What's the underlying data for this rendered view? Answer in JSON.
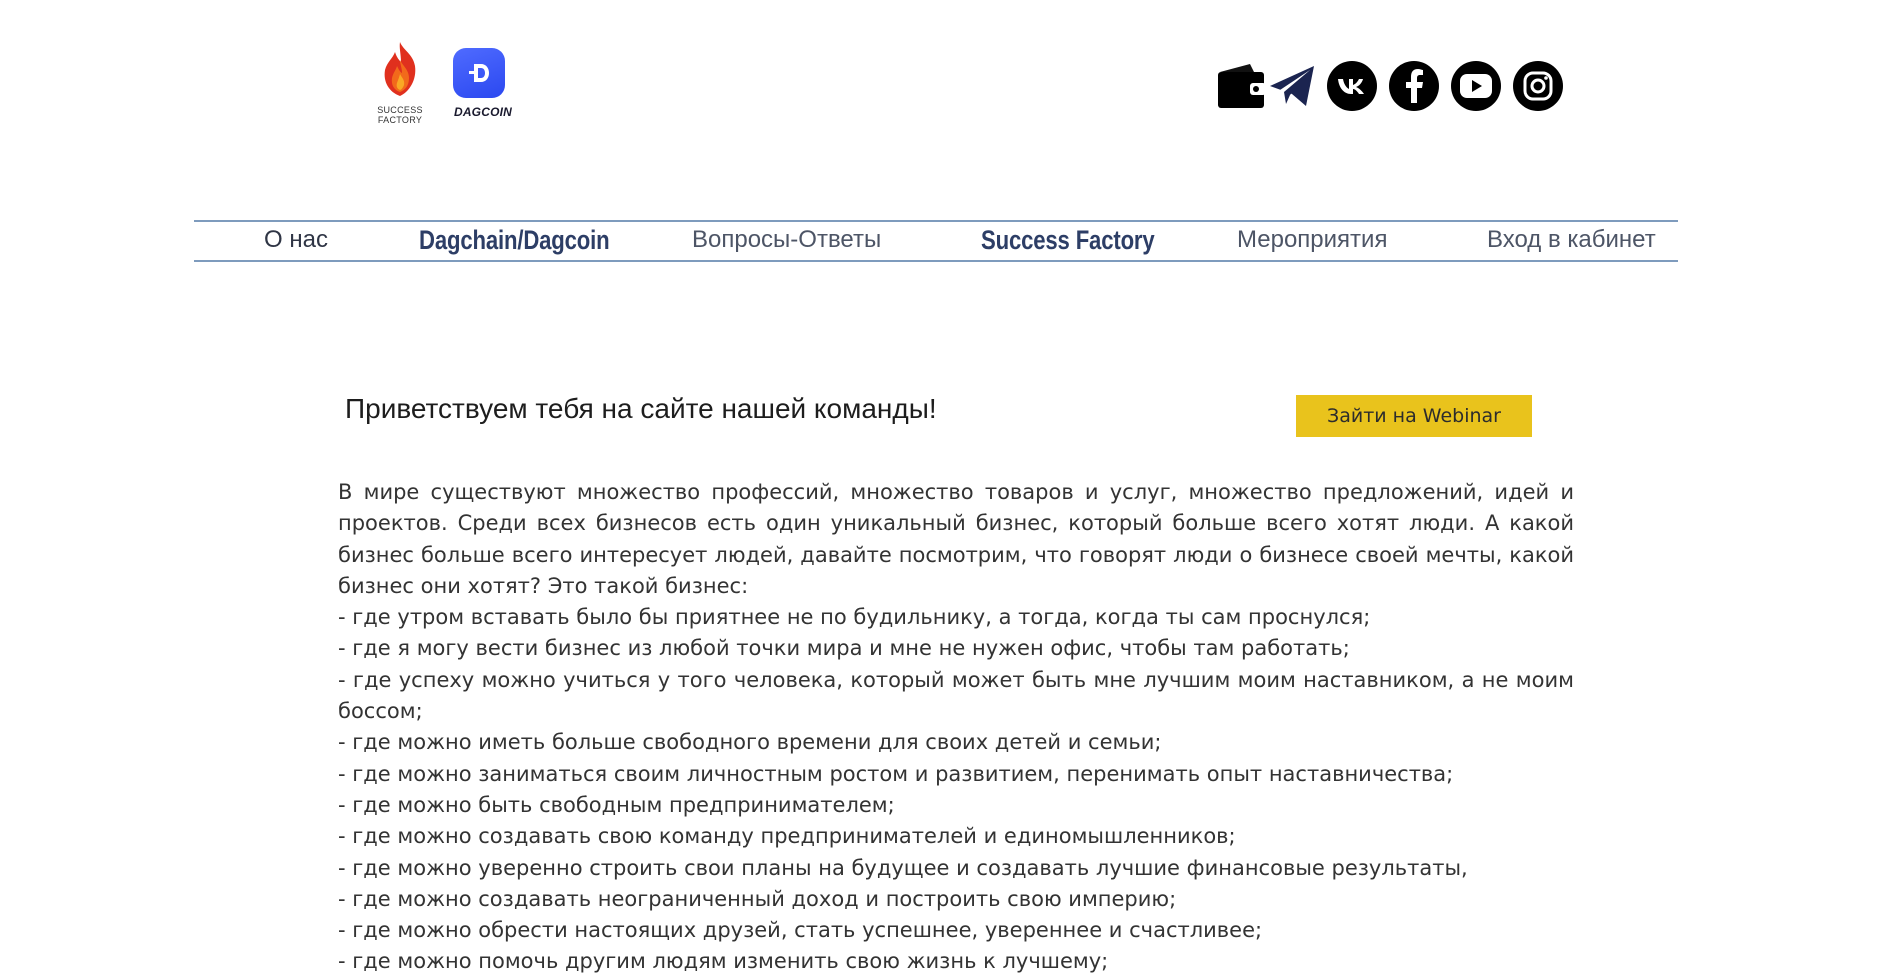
{
  "header": {
    "logo_success_factory": {
      "line1": "SUCCESS",
      "line2": "FACTORY"
    },
    "logo_dagcoin": {
      "word": "DAGCOIN"
    },
    "social_icons": [
      "wallet-icon",
      "telegram-icon",
      "vk-icon",
      "facebook-icon",
      "youtube-icon",
      "instagram-icon"
    ]
  },
  "nav": {
    "items": [
      {
        "label": "О нас"
      },
      {
        "label": "Dagchain/Dagcoin"
      },
      {
        "label": "Вопросы-Ответы"
      },
      {
        "label": "Success Factory"
      },
      {
        "label": "Мероприятия"
      },
      {
        "label": "Вход в кабинет"
      }
    ]
  },
  "main": {
    "greeting": "Приветствуем тебя на сайте нашей команды!",
    "webinar_button": "Зайти на Webinar",
    "intro": "В мире существуют множество профессий, множество товаров и услуг, множество предложений, идей и проектов. Среди всех бизнесов есть один уникальный бизнес, который больше всего хотят люди. А какой бизнес больше всего интересует людей, давайте посмотрим, что говорят люди о бизнесе своей мечты, какой бизнес они хотят? Это такой бизнес:",
    "bullets": [
      "- где утром вставать было бы приятнее не по будильнику, а тогда, когда ты сам проснулся;",
      "- где я могу вести бизнес из любой точки мира и мне не нужен офис, чтобы там работать;",
      "- где успеху можно учиться у того человека, который может быть мне лучшим моим наставником, а не моим  боссом;",
      "- где можно иметь больше свободного времени для своих детей и семьи;",
      "- где можно заниматься своим личностным ростом и развитием, перенимать опыт наставничества;",
      "- где можно быть свободным предпринимателем;",
      "- где можно создавать свою команду предпринимателей и единомышленников;",
      "- где можно уверенно строить свои планы на будущее и создавать лучшие финансовые результаты,",
      "- где можно создавать неограниченный доход и построить свою империю;",
      "- где можно обрести настоящих друзей, стать успешнее, увереннее и счастливее;",
      "- где можно помочь другим людям изменить свою жизнь к лучшему;"
    ]
  },
  "colors": {
    "nav_line": "#7e9bbd",
    "nav_bold": "#2d3e66",
    "button_bg": "#e9c31c",
    "dagcoin_blue": "#3552f5",
    "flame_red": "#e0301e",
    "telegram_navy": "#1b2450"
  }
}
